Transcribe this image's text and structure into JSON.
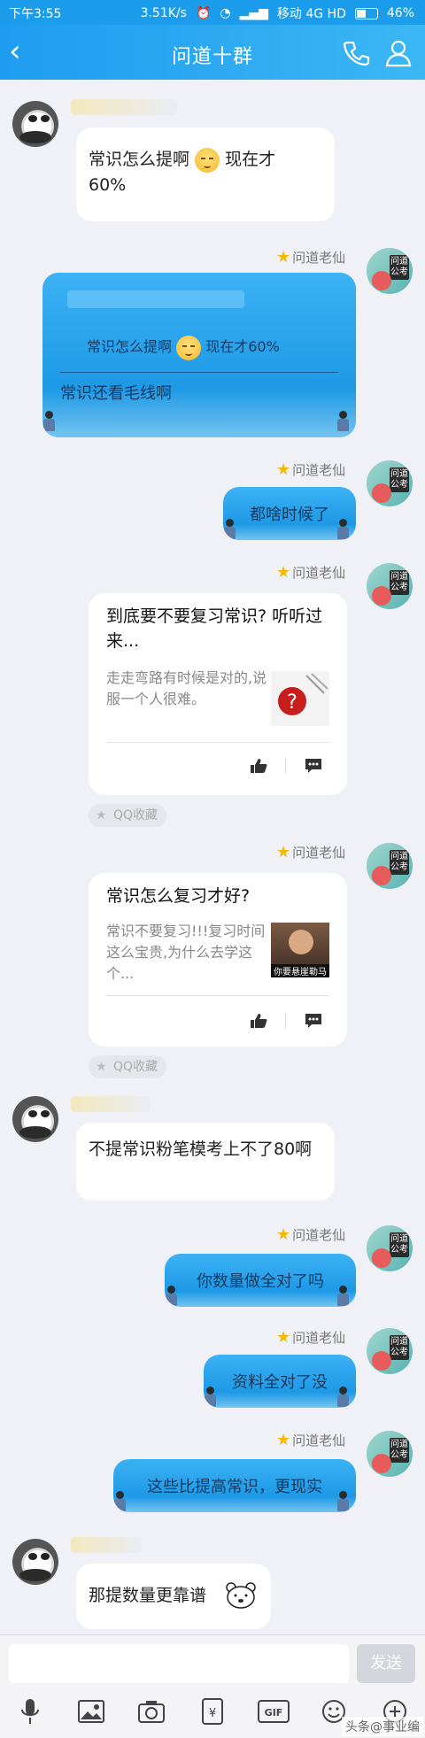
{
  "status": {
    "time": "下午3:55",
    "speed": "3.51K/s",
    "network": "移动 4G HD",
    "battery": "46%"
  },
  "header": {
    "title": "问道十群"
  },
  "nick": "问道老仙",
  "messages": {
    "m1": {
      "text1": "常识怎么提啊",
      "text2": "现在才",
      "text3": "60%"
    },
    "m2": {
      "quote": "常识怎么提啊",
      "quote_tail": "现在才60%",
      "reply": "常识还看毛线啊"
    },
    "m3": {
      "text": "都啥时候了"
    },
    "card1": {
      "title": "到底要不要复习常识? 听听过来...",
      "desc": "走走弯路有时候是对的,说服一个人很难。",
      "tag": "QQ收藏"
    },
    "card2": {
      "title": "常识怎么复习才好?",
      "desc": "常识不要复习!!!复习时间这么宝贵,为什么去学这个...",
      "thumb_caption": "你要悬崖勒马",
      "tag": "QQ收藏"
    },
    "m4": {
      "text": "不提常识粉笔模考上不了80啊"
    },
    "m5": {
      "text": "你数量做全对了吗"
    },
    "m6": {
      "text": "资料全对了没"
    },
    "m7": {
      "text": "这些比提高常识，更现实"
    },
    "m8": {
      "text": "那提数量更靠谱"
    }
  },
  "composer": {
    "send": "发送",
    "watermark": "头条@事业编"
  },
  "icons": [
    "microphone-icon",
    "image-icon",
    "camera-icon",
    "red-packet-icon",
    "gif-icon",
    "emoji-icon",
    "plus-icon"
  ]
}
